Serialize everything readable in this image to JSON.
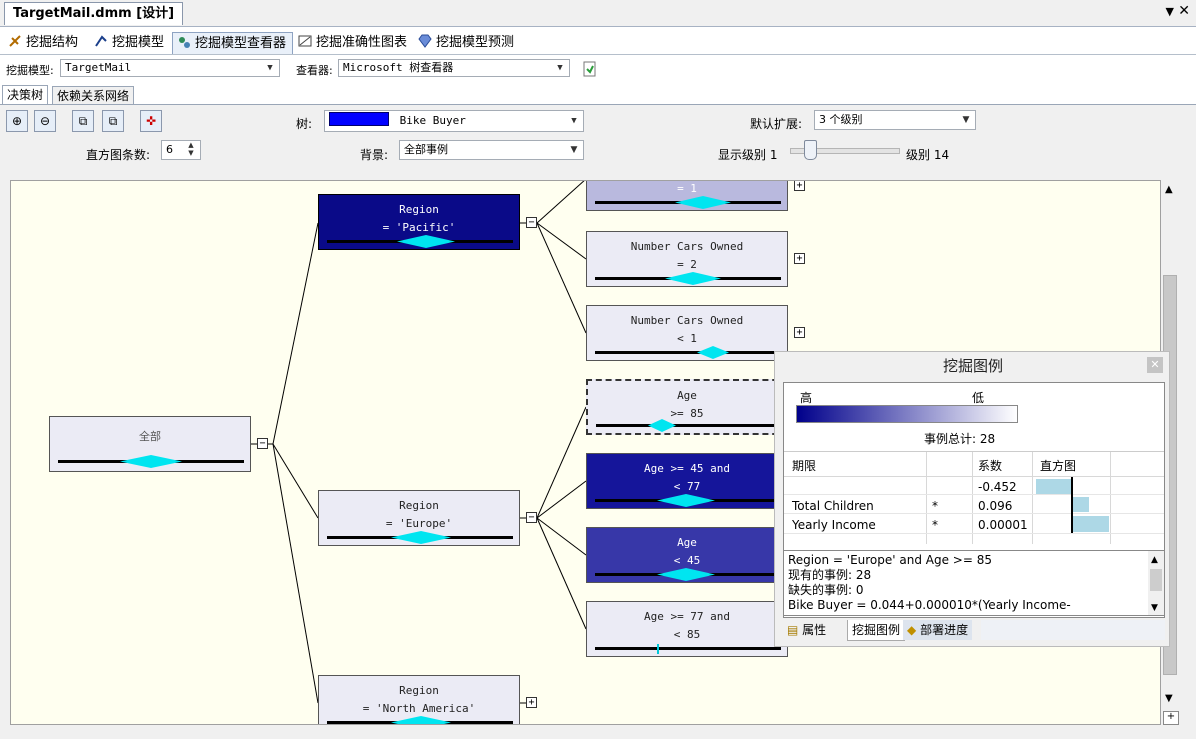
{
  "document": {
    "tab_title": "TargetMail.dmm [设计]",
    "dropdown_icon": "dropdown-arrow",
    "close_icon": "close"
  },
  "designer_tabs": [
    {
      "label": "挖掘结构",
      "icon": "structure-icon"
    },
    {
      "label": "挖掘模型",
      "icon": "model-icon"
    },
    {
      "label": "挖掘模型查看器",
      "icon": "viewer-icon"
    },
    {
      "label": "挖掘准确性图表",
      "icon": "chart-icon"
    },
    {
      "label": "挖掘模型预测",
      "icon": "prediction-icon"
    }
  ],
  "toolbar": {
    "model_label": "挖掘模型:",
    "model_value": "TargetMail",
    "viewer_label": "查看器:",
    "viewer_value": "Microsoft 树查看器"
  },
  "view_tabs": [
    "决策树",
    "依赖关系网络"
  ],
  "tree_controls": {
    "tree_label": "树:",
    "tree_value": "Bike Buyer",
    "tree_color": "#0000ff",
    "default_expand_label": "默认扩展:",
    "default_expand_value": "3 个级别",
    "hist_label": "直方图条数:",
    "hist_value": "6",
    "background_label": "背景:",
    "background_value": "全部事例",
    "show_level_label": "显示级别",
    "show_level_min": "1",
    "level_label": "级别",
    "level_max": "14"
  },
  "tree_nodes": {
    "root": {
      "l1": "全部",
      "l2": ""
    },
    "pacific": {
      "l1": "Region",
      "l2": "= 'Pacific'"
    },
    "europe": {
      "l1": "Region",
      "l2": "= 'Europe'"
    },
    "north_america": {
      "l1": "Region",
      "l2": "= 'North America'"
    },
    "cut": {
      "l1": "",
      "l2": "= 1"
    },
    "cars2": {
      "l1": "Number Cars Owned",
      "l2": "= 2"
    },
    "cars_lt1": {
      "l1": "Number Cars Owned",
      "l2": "< 1"
    },
    "age85": {
      "l1": "Age",
      "l2": ">= 85"
    },
    "age45_77": {
      "l1": "Age >= 45 and",
      "l2": "< 77"
    },
    "age45": {
      "l1": "Age",
      "l2": "< 45"
    },
    "age77_85": {
      "l1": "Age >= 77 and",
      "l2": "< 85"
    }
  },
  "legend": {
    "title": "挖掘图例",
    "high": "高",
    "low": "低",
    "gradient": {
      "from": "#00008b",
      "to": "#ffffff"
    },
    "total_label": "事例总计:",
    "total_value": "28",
    "headers": [
      "期限",
      "",
      "系数",
      "直方图"
    ],
    "rows": [
      {
        "term": "",
        "star": "",
        "coef": "-0.452"
      },
      {
        "term": "Total Children",
        "star": "*",
        "coef": "0.096"
      },
      {
        "term": "Yearly Income",
        "star": "*",
        "coef": "0.00001"
      }
    ],
    "info_lines": [
      "Region = 'Europe' and Age >= 85",
      "现有的事例: 28",
      "缺失的事例: 0",
      "Bike Buyer = 0.044+0.000010*(Yearly Income-"
    ],
    "bottom_tabs": [
      "属性",
      "挖掘图例",
      "部署进度"
    ]
  }
}
